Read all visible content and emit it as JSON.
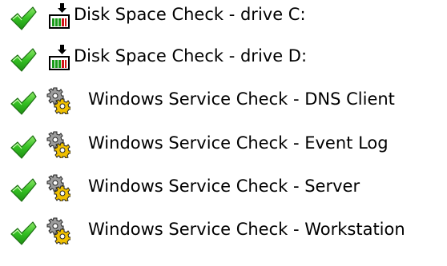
{
  "colors": {
    "status_ok_green": "#2db51c",
    "text": "#000000",
    "disk_bar_green": "#1a9c1a",
    "disk_bar_red": "#d11414",
    "gear_gold": "#e8b800"
  },
  "checks": [
    {
      "label": "Disk Space Check - drive C:",
      "status": "ok",
      "status_icon": "green-checkmark-icon",
      "type_icon": "disk-space-icon"
    },
    {
      "label": "Disk Space Check - drive D:",
      "status": "ok",
      "status_icon": "green-checkmark-icon",
      "type_icon": "disk-space-icon"
    },
    {
      "label": "Windows Service Check - DNS Client",
      "status": "ok",
      "status_icon": "green-checkmark-icon",
      "type_icon": "windows-service-gears-icon"
    },
    {
      "label": "Windows Service Check - Event Log",
      "status": "ok",
      "status_icon": "green-checkmark-icon",
      "type_icon": "windows-service-gears-icon"
    },
    {
      "label": "Windows Service Check - Server",
      "status": "ok",
      "status_icon": "green-checkmark-icon",
      "type_icon": "windows-service-gears-icon"
    },
    {
      "label": "Windows Service Check - Workstation",
      "status": "ok",
      "status_icon": "green-checkmark-icon",
      "type_icon": "windows-service-gears-icon"
    }
  ]
}
